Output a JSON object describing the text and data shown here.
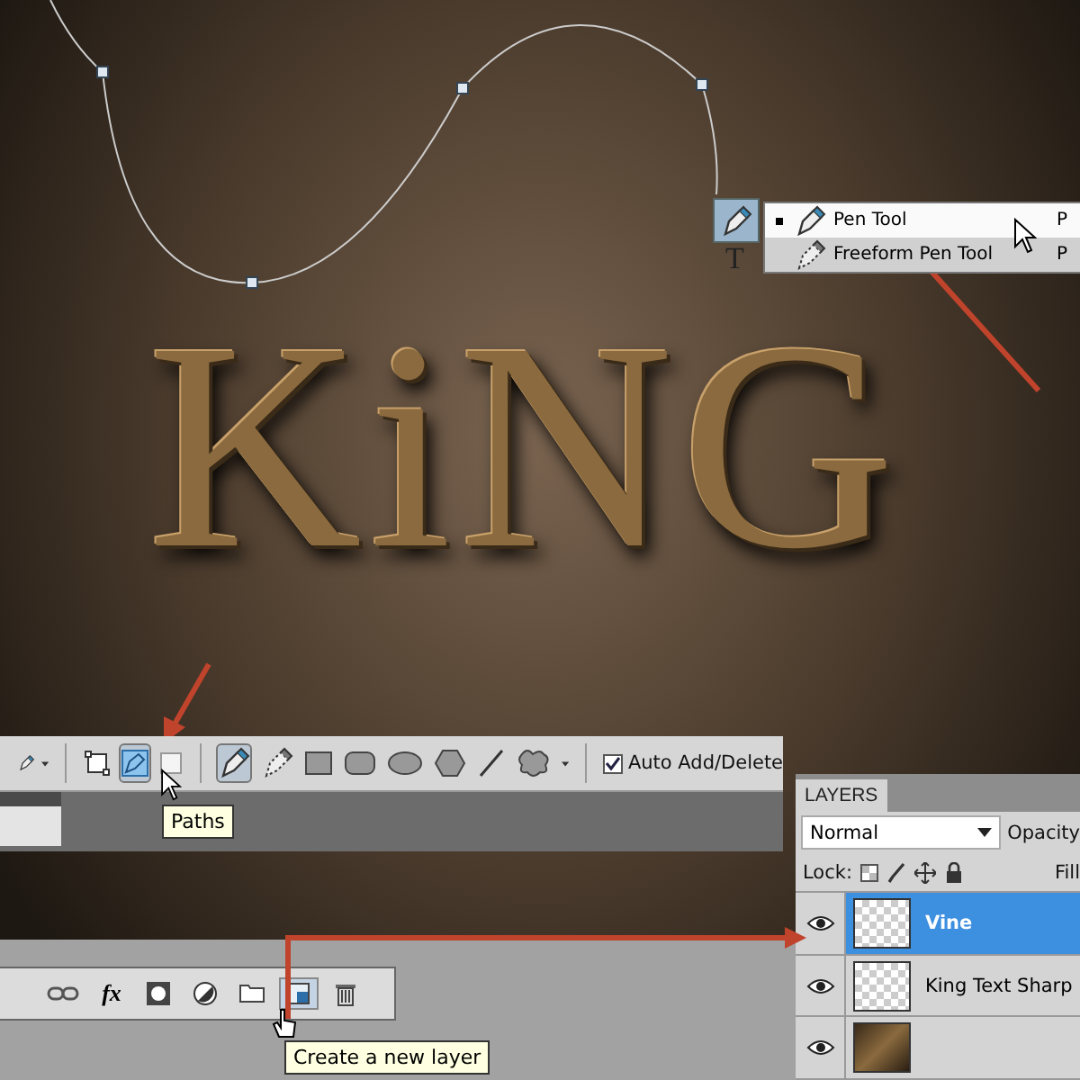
{
  "canvas": {
    "artwork_text": "KiNG"
  },
  "tools_panel": {
    "type_tool": "T"
  },
  "tool_flyout": {
    "items": [
      {
        "label": "Pen Tool",
        "shortcut": "P",
        "selected": true
      },
      {
        "label": "Freeform Pen Tool",
        "shortcut": "P",
        "selected": false
      }
    ]
  },
  "options_bar": {
    "path_modes": [
      {
        "kind": "shape-layers",
        "selected": false
      },
      {
        "kind": "paths",
        "selected": true
      },
      {
        "kind": "fill-pixels",
        "selected": false
      }
    ],
    "tools": [
      {
        "kind": "pen",
        "selected": true
      },
      {
        "kind": "freeform-pen",
        "selected": false
      },
      {
        "kind": "rectangle",
        "selected": false
      },
      {
        "kind": "rounded-rectangle",
        "selected": false
      },
      {
        "kind": "ellipse",
        "selected": false
      },
      {
        "kind": "polygon",
        "selected": false
      },
      {
        "kind": "line",
        "selected": false
      },
      {
        "kind": "custom-shape",
        "selected": false
      }
    ],
    "auto_add_delete": {
      "label": "Auto Add/Delete",
      "checked": true
    },
    "tooltip": "Paths"
  },
  "layers_panel": {
    "tab": "LAYERS",
    "blend_mode": "Normal",
    "opacity_label": "Opacity",
    "lock_label": "Lock:",
    "fill_label": "Fill",
    "layers": [
      {
        "name": "Vine",
        "kind": "transparent",
        "selected": true,
        "visible": true
      },
      {
        "name": "King Text Sharp",
        "kind": "text",
        "selected": false,
        "visible": true
      },
      {
        "kind": "image",
        "selected": false,
        "visible": true
      }
    ],
    "buttons": [
      {
        "kind": "link",
        "hovered": false
      },
      {
        "kind": "fx",
        "label": "fx",
        "hovered": false
      },
      {
        "kind": "mask",
        "hovered": false
      },
      {
        "kind": "adjustment",
        "hovered": false
      },
      {
        "kind": "group",
        "hovered": false
      },
      {
        "kind": "new-layer",
        "hovered": true
      },
      {
        "kind": "delete",
        "hovered": false
      }
    ],
    "tooltip": "Create a new layer"
  }
}
